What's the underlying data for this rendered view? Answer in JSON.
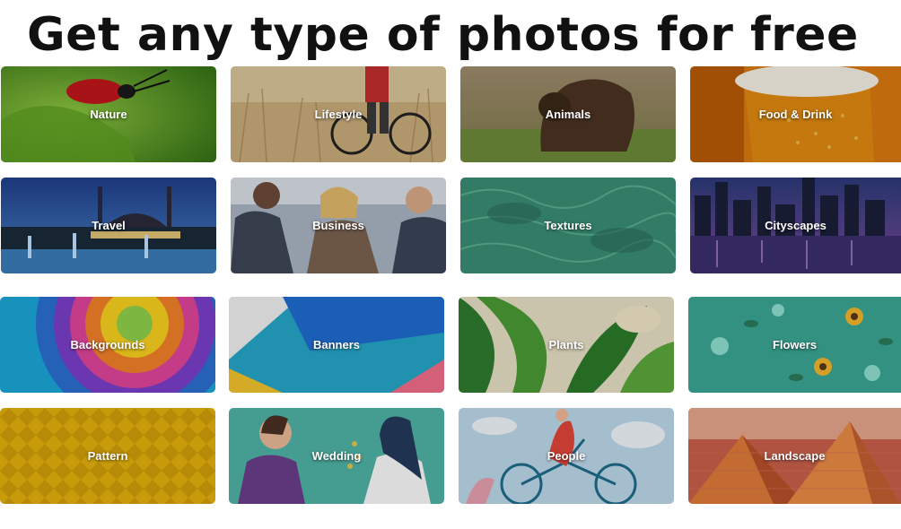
{
  "headline": "Get any type of photos for free",
  "categories": [
    {
      "label": "Nature"
    },
    {
      "label": "Lifestyle"
    },
    {
      "label": "Animals"
    },
    {
      "label": "Food & Drink"
    },
    {
      "label": "Travel"
    },
    {
      "label": "Business"
    },
    {
      "label": "Textures"
    },
    {
      "label": "Cityscapes"
    },
    {
      "label": "Backgrounds"
    },
    {
      "label": "Banners"
    },
    {
      "label": "Plants"
    },
    {
      "label": "Flowers"
    },
    {
      "label": "Pattern"
    },
    {
      "label": "Wedding"
    },
    {
      "label": "People"
    },
    {
      "label": "Landscape"
    }
  ]
}
